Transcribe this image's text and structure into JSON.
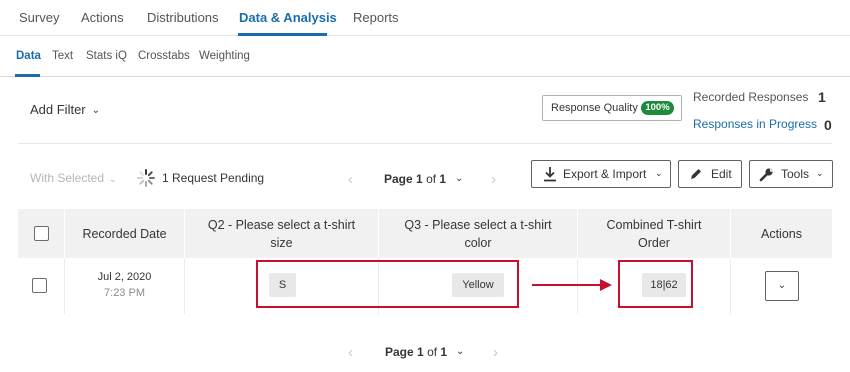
{
  "top_tabs": [
    "Survey",
    "Actions",
    "Distributions",
    "Data & Analysis",
    "Reports"
  ],
  "top_tabs_active": "Data & Analysis",
  "sub_tabs": [
    "Data",
    "Text",
    "Stats iQ",
    "Crosstabs",
    "Weighting"
  ],
  "sub_tabs_active": "Data",
  "filter": {
    "add_filter_label": "Add Filter"
  },
  "response_quality": {
    "label": "Response Quality",
    "badge": "100%"
  },
  "responses": {
    "recorded_label": "Recorded Responses",
    "recorded_count": "1",
    "in_progress_label": "Responses in Progress",
    "in_progress_count": "0"
  },
  "toolbar": {
    "with_selected": "With Selected",
    "pending_text": "1 Request Pending",
    "page_word": "Page",
    "page_current": "1",
    "page_of": "of",
    "page_total": "1",
    "export_label": "Export & Import",
    "edit_label": "Edit",
    "tools_label": "Tools"
  },
  "table": {
    "headers": {
      "date": "Recorded Date",
      "q2": "Q2 - Please select a t-shirt size",
      "q3": "Q3 - Please select a t-shirt color",
      "combined": "Combined T-shirt Order",
      "actions": "Actions"
    },
    "row": {
      "date": "Jul 2, 2020",
      "time": "7:23 PM",
      "q2": "S",
      "q3": "Yellow",
      "combined": "18|62"
    }
  },
  "colors": {
    "accent": "#1a6dac",
    "highlight": "#c5102e",
    "badge_green": "#1e8a3b"
  }
}
